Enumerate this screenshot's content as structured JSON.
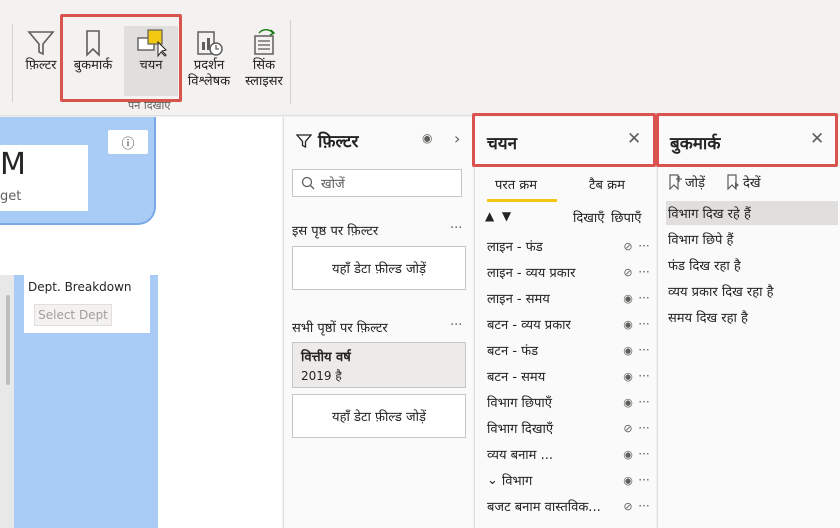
{
  "ribbon": {
    "filter_label": "फ़िल्टर",
    "bookmark_label": "बुकमार्क",
    "selection_label": "चयन",
    "perf_line1": "प्रदर्शन",
    "perf_line2": "विश्लेषक",
    "sync_line1": "सिंक",
    "sync_line2": "स्लाइसर",
    "group_label": "पैन दिखाएँ"
  },
  "canvas": {
    "big_letter": "M",
    "sub_text": "get",
    "info_icon": "ⓘ",
    "dept_title": "Dept. Breakdown",
    "dept_placeholder": "Select Dept"
  },
  "filter_pane": {
    "title": "फ़िल्टर",
    "search_placeholder": "खोजें",
    "this_page": "इस पृष्ठ पर फ़िल्टर",
    "add_field_1": "यहाँ डेटा फ़ील्ड जोड़ें",
    "all_pages": "सभी पृष्ठों पर फ़िल्टर",
    "card_title": "वित्तीय वर्ष",
    "card_value": "2019 है",
    "add_field_2": "यहाँ डेटा फ़ील्ड जोड़ें",
    "dots": "···"
  },
  "selection_pane": {
    "title": "चयन",
    "close": "✕",
    "tab_layer": "परत क्रम",
    "tab_order": "टैब क्रम",
    "show_all": "दिखाएँ",
    "hide_all": "छिपाएँ",
    "items": [
      {
        "label": "लाइन - फंड",
        "visible": false
      },
      {
        "label": "लाइन - व्यय प्रकार",
        "visible": false
      },
      {
        "label": "लाइन - समय",
        "visible": true
      },
      {
        "label": "बटन - व्यय प्रकार",
        "visible": true
      },
      {
        "label": "बटन - फंड",
        "visible": true
      },
      {
        "label": "बटन - समय",
        "visible": true
      },
      {
        "label": "विभाग छिपाएँ",
        "visible": true
      },
      {
        "label": "विभाग दिखाएँ",
        "visible": false
      },
      {
        "label": "व्यय बनाम ...",
        "visible": true
      },
      {
        "label": "विभाग",
        "visible": true,
        "group": true
      },
      {
        "label": "बजट बनाम वास्तविक...",
        "visible": false
      }
    ]
  },
  "bookmark_pane": {
    "title": "बुकमार्क",
    "close": "✕",
    "add_label": "जोड़ें",
    "view_label": "देखें",
    "items": [
      {
        "label": "विभाग दिख रहे हैं",
        "selected": true
      },
      {
        "label": "विभाग छिपे हैं",
        "selected": false
      },
      {
        "label": "फंड दिख रहा है",
        "selected": false
      },
      {
        "label": "व्यय प्रकार दिख रहा है",
        "selected": false
      },
      {
        "label": "समय दिख रहा है",
        "selected": false
      }
    ]
  },
  "colors": {
    "highlight": "#d9534f",
    "accent": "#f2c811",
    "card_blue": "#a9ccf7"
  }
}
